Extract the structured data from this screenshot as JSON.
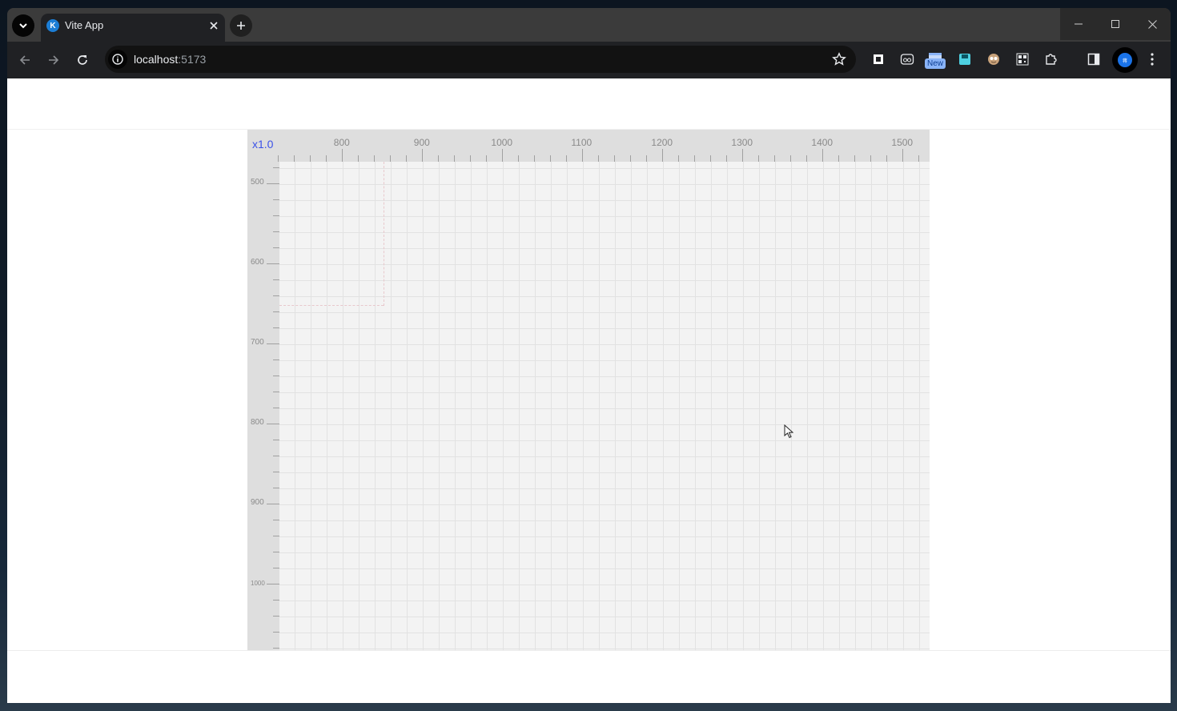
{
  "browser": {
    "tab_title": "Vite App",
    "tab_favicon_letter": "K",
    "address": {
      "host": "localhost",
      "port": ":5173"
    },
    "extension_badge": "New",
    "profile_initial": "蒋"
  },
  "editor": {
    "zoom_label": "x1.0",
    "ruler_x_labels": [
      "800",
      "900",
      "1000",
      "1100",
      "1200",
      "1300",
      "1400",
      "1500"
    ],
    "ruler_y_labels": [
      "500",
      "600",
      "700",
      "800",
      "900",
      "1000"
    ]
  },
  "colors": {
    "zoom_label": "#3b52e8",
    "canvas_bg": "#f3f3f3",
    "ruler_bg": "#dedede",
    "guide": "#e8c8cc"
  },
  "icons": {
    "tab_search": "chevron-down-icon",
    "tab_close": "close-icon",
    "new_tab": "plus-icon",
    "back": "arrow-left-icon",
    "forward": "arrow-right-icon",
    "reload": "reload-icon",
    "site_info": "info-icon",
    "bookmark": "star-icon",
    "extensions": "puzzle-icon",
    "side_panel": "side-panel-icon",
    "menu": "kebab-menu-icon"
  }
}
